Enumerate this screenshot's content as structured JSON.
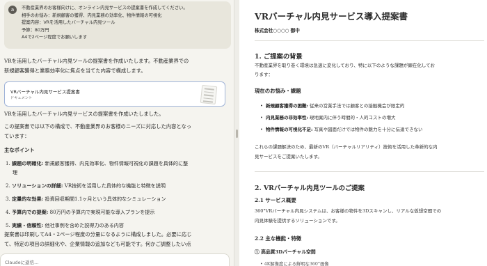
{
  "chat": {
    "user_message": {
      "avatar_letter": "a",
      "lines": [
        "不動産業界のお客様向けに、オンライン内見サービスの提案書を作成してください。",
        "相手のお悩み：新規顧客の獲得、内見業務の効率化、物件情報の可視化",
        "提案内容：VRを活用したバーチャル内見ツール",
        "予算：80万円",
        "A4で2ページ程度でお願いします"
      ]
    },
    "intro_lines": [
      "VRを活用したバーチャル内見ツールの提案書を作成いたします。不動産業界での",
      "新規顧客獲得と業務効率化に焦点を当てた内容で構成します。"
    ],
    "artifact": {
      "title": "VRバーチャル内見サービス提案書",
      "subtitle": "ドキュメント"
    },
    "after_card": "VRを活用したバーチャル内見サービスの提案書を作成いたしました。",
    "structure_lines": [
      "この提案書では以下の構成で、不動産業界のお客様のニーズに対応した内容となっ",
      "ています："
    ],
    "points_heading": "主なポイント",
    "points": [
      {
        "num": "1.",
        "bold": "課題の明確化:",
        "text": " 新規顧客獲得、内見効率化、物件情報可視化の課題を具体的に整",
        "cont": "理"
      },
      {
        "num": "2.",
        "bold": "ソリューションの詳細:",
        "text": " VR技術を活用した具体的な機能と特徴を説明",
        "cont": ""
      },
      {
        "num": "3.",
        "bold": "定量的な効果:",
        "text": " 投資回収期間1.1ヶ月という具体的なシミュレーション",
        "cont": ""
      },
      {
        "num": "4.",
        "bold": "予算内での提案:",
        "text": " 80万円の予算内で実現可能な導入プランを提示",
        "cont": ""
      },
      {
        "num": "5.",
        "bold": "実績・信頼性:",
        "text": " 他社事例を含めた説得力のある内容",
        "cont": ""
      }
    ],
    "closing_lines": [
      "提案書は印刷してA4・2ページ程度の分量になるように構成しました。必要に応じ",
      "て、特定の項目の詳細化や、企業情報の追加なども可能です。何かご調整したい点"
    ],
    "input_placeholder": "Claudeに返信..."
  },
  "document": {
    "title": "VRバーチャル内見サービス導入提案書",
    "addressee": "株式会社○○○○ 御中",
    "section1_heading": "1. ご提案の背景",
    "section1_lines": [
      "不動産業界を取り巻く環境は急速に変化しており、特に以下のような課題が顕在化してお",
      "ります："
    ],
    "concerns_heading": "現在のお悩み・課題",
    "concerns": [
      {
        "bold": "新規顧客獲得の困難:",
        "text": " 従来の営業手法では顧客との接触機会が限定的"
      },
      {
        "bold": "内見業務の非効率性:",
        "text": " 現地案内に伴う時間的・人的コストの増大"
      },
      {
        "bold": "物件情報の可視化不足:",
        "text": " 写真や図面だけでは物件の魅力を十分に伝達できない"
      }
    ],
    "solution_lines": [
      "これらの課題解決のため、最新のVR（バーチャルリアリティ）技術を活用した革新的な内",
      "見サービスをご提案いたします。"
    ],
    "section2_heading": "2. VRバーチャル内見ツールのご提案",
    "sub21_heading": "2.1 サービス概要",
    "sub21_lines": [
      "360°VRバーチャル内見システムは、お客様の物件を3Dスキャンし、リアルな仮想空間での",
      "内見体験を提供するソリューションです。"
    ],
    "sub22_heading": "2.2 主な機能・特徴",
    "feature1_heading": "① 高品質3Dバーチャル空間",
    "feature1_cut": "• 4K解像度による鮮明な360°画像"
  }
}
